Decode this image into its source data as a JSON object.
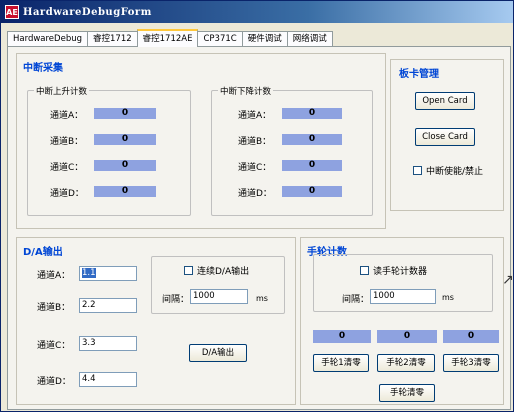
{
  "window": {
    "title": "HardwareDebugForm",
    "icon": "app-icon"
  },
  "tabs": [
    "HardwareDebug",
    "睿控1712",
    "睿控1712AE",
    "CP371C",
    "硬件调试",
    "网络调试"
  ],
  "active_tab": 2,
  "interrupt": {
    "title": "中断采集",
    "rise": {
      "title": "中断上升计数",
      "rows": [
        {
          "label": "通道A：",
          "value": "0"
        },
        {
          "label": "通道B：",
          "value": "0"
        },
        {
          "label": "通道C：",
          "value": "0"
        },
        {
          "label": "通道D：",
          "value": "0"
        }
      ]
    },
    "fall": {
      "title": "中断下降计数",
      "rows": [
        {
          "label": "通道A：",
          "value": "0"
        },
        {
          "label": "通道B：",
          "value": "0"
        },
        {
          "label": "通道C：",
          "value": "0"
        },
        {
          "label": "通道D：",
          "value": "0"
        }
      ]
    }
  },
  "board": {
    "title": "板卡管理",
    "open_label": "Open Card",
    "close_label": "Close Card",
    "interrupt_toggle_label": "中断使能/禁止"
  },
  "da": {
    "title": "D/A输出",
    "channels": [
      {
        "label": "通道A：",
        "value": "1.1"
      },
      {
        "label": "通道B：",
        "value": "2.2"
      },
      {
        "label": "通道C：",
        "value": "3.3"
      },
      {
        "label": "通道D：",
        "value": "4.4"
      }
    ],
    "continuous_label": "连续D/A输出",
    "interval_label": "间隔：",
    "interval_value": "1000",
    "interval_unit": "ms",
    "output_button": "D/A输出"
  },
  "handwheel": {
    "title": "手轮计数",
    "read_label": "读手轮计数器",
    "interval_label": "间隔：",
    "interval_value": "1000",
    "interval_unit": "ms",
    "counters": [
      "0",
      "0",
      "0"
    ],
    "clear_buttons": [
      "手轮1清零",
      "手轮2清零",
      "手轮3清零"
    ],
    "clear_all": "手轮清零"
  },
  "colors": {
    "accent": "#0046d5",
    "bar": "#8ea2e0"
  }
}
